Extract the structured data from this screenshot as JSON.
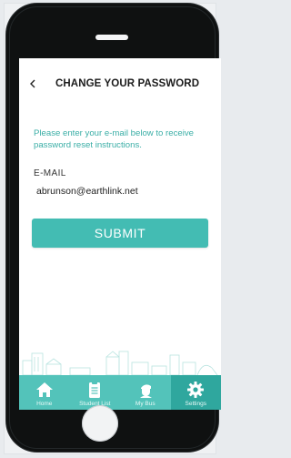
{
  "header": {
    "back_icon": "chevron-left-icon",
    "title": "CHANGE YOUR PASSWORD"
  },
  "form": {
    "instructions": "Please enter your e-mail below to receive password reset instructions.",
    "email_label": "E-MAIL",
    "email_value": "abrunson@earthlink.net",
    "submit_label": "SUBMIT"
  },
  "tabbar": {
    "tabs": [
      {
        "label": "Home",
        "icon": "home-icon",
        "active": false
      },
      {
        "label": "Student List",
        "icon": "clipboard-icon",
        "active": false
      },
      {
        "label": "My Bus",
        "icon": "bus-driver-icon",
        "active": false
      },
      {
        "label": "Settings",
        "icon": "gear-icon",
        "active": true
      }
    ]
  },
  "colors": {
    "accent": "#43bcb3",
    "tabbar": "#53c3ba",
    "tab_active": "#2fa79e",
    "instructions_text": "#3aaea6",
    "phone_body": "#0f1111"
  }
}
